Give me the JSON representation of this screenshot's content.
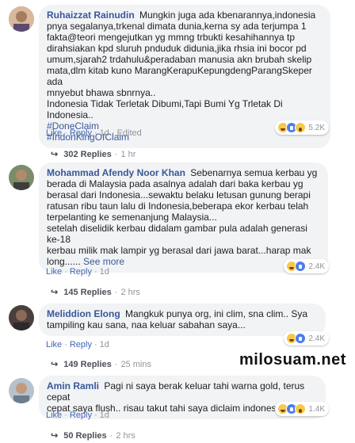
{
  "comments": [
    {
      "author": "Ruhaizzat Rainudin",
      "lines": [
        "Mungkin juga ada kbenarannya,indonesia",
        "pnya segalanya,trkenal dimata dunia,kerna sy ada terjumpa 1",
        "fakta@teori mengejutkan yg mmng trbukti kesahihannya tp",
        "dirahsiakan kpd sluruh pnduduk didunia,jika rhsia ini bocor pd",
        "umum,sjarah2 trdahulu&peradaban manusia akn brubah skelip",
        "mata,dlm kitab kuno MarangKerapuKepungdengParangSkeper ada",
        "mnyebut bhawa sbnrnya..",
        "Indonesia Tidak Terletak Dibumi,Tapi Bumi Yg Trletak Di Indonesia.."
      ],
      "hashtags": [
        "#DoneClaim",
        "#IndonKingOfClaim"
      ],
      "like": "Like",
      "reply": "Reply",
      "time": "1d",
      "edited": "Edited",
      "reaction_count": "5.2K",
      "replies_label": "302 Replies",
      "replies_time": "1 hr"
    },
    {
      "author": "Mohammad Afendy Noor Khan",
      "lines": [
        "Sebenarnya semua kerbau yg",
        "berada di Malaysia pada asalnya adalah dari baka kerbau yg",
        "berasal dari Indonesia...sewaktu belaku letusan gunung berapi",
        "ratusan ribu taun lalu di Indonesia,beberapa ekor kerbau telah",
        "terpelanting ke semenanjung Malaysia...",
        "setelah diselidik kerbau didalam gambar pula adalah generasi ke-18",
        "kerbau milik mak lampir yg berasal dari jawa barat...harap mak",
        "long......"
      ],
      "see_more": "See more",
      "like": "Like",
      "reply": "Reply",
      "time": "1d",
      "reaction_count": "2.4K",
      "replies_label": "145 Replies",
      "replies_time": "2 hrs"
    },
    {
      "author": "Meliddion Elong",
      "lines": [
        "Mangkuk punya org, ini clim, sna clim.. Sya",
        "tampiling kau sana, naa keluar sabahan saya..."
      ],
      "like": "Like",
      "reply": "Reply",
      "time": "1d",
      "reaction_count": "2.4K",
      "replies_label": "149 Replies",
      "replies_time": "25 mins"
    },
    {
      "author": "Amin Ramli",
      "lines": [
        "Pagi ni saya berak keluar tahi warna gold, terus cepat",
        "cepat saya flush.. risau takut tahi saya diclaim indonesia."
      ],
      "like": "Like",
      "reply": "Reply",
      "time": "1d",
      "reaction_count": "1.4K",
      "replies_label": "50 Replies",
      "replies_time": "2 hrs"
    }
  ],
  "watermark": "milosuam.net",
  "colors": {
    "link": "#385898",
    "bubble": "#f2f3f5",
    "meta": "#90949c"
  }
}
